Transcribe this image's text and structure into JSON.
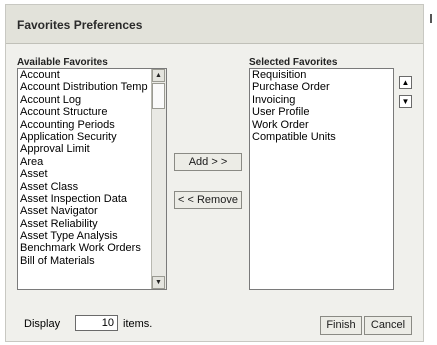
{
  "dialog": {
    "title": "Favorites Preferences"
  },
  "available": {
    "label": "Available Favorites",
    "items": [
      "Account",
      "Account Distribution Temp",
      "Account Log",
      "Account Structure",
      "Accounting Periods",
      "Application Security",
      "Approval Limit",
      "Area",
      "Asset",
      "Asset Class",
      "Asset Inspection Data",
      "Asset Navigator",
      "Asset Reliability",
      "Asset Type Analysis",
      "Benchmark Work Orders",
      "Bill of Materials"
    ],
    "scroll_up_icon": "triangle-up",
    "scroll_down_icon": "triangle-down"
  },
  "selected": {
    "label": "Selected Favorites",
    "items": [
      "Requisition",
      "Purchase Order",
      "Invoicing",
      "User Profile",
      "Work Order",
      "Compatible Units"
    ],
    "move_up_icon": "arrow-up",
    "move_down_icon": "arrow-down"
  },
  "actions": {
    "add_label": "Add > >",
    "remove_label": "< < Remove"
  },
  "footer": {
    "display_label": "Display",
    "display_value": "10",
    "items_label": "items.",
    "finish_label": "Finish",
    "cancel_label": "Cancel"
  }
}
